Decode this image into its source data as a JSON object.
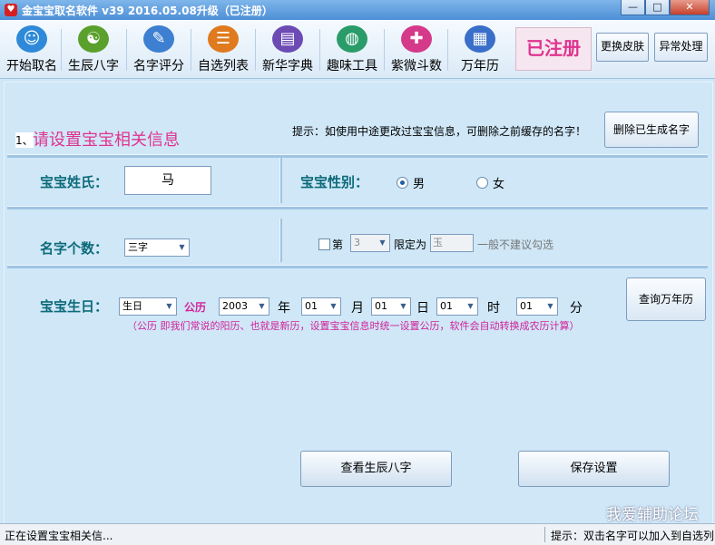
{
  "window": {
    "title": "金宝宝取名软件 v39   2016.05.08升级（已注册）",
    "minimize": "—",
    "maximize": "□",
    "close": "✕"
  },
  "toolbar": {
    "items": [
      {
        "label": "开始取名",
        "icon": "people-icon",
        "color": "#2e8ad8"
      },
      {
        "label": "生辰八字",
        "icon": "bagua-icon",
        "color": "#5aa02c"
      },
      {
        "label": "名字评分",
        "icon": "score-icon",
        "color": "#3d7fd0"
      },
      {
        "label": "自选列表",
        "icon": "list-icon",
        "color": "#e07a1f"
      },
      {
        "label": "新华字典",
        "icon": "dictionary-icon",
        "color": "#6c4bb5"
      },
      {
        "label": "趣味工具",
        "icon": "globe-icon",
        "color": "#2a9c6a"
      },
      {
        "label": "紫微斗数",
        "icon": "star-icon",
        "color": "#d5398a"
      },
      {
        "label": "万年历",
        "icon": "calendar-icon",
        "color": "#3a6fc9"
      }
    ],
    "registered_label": "已注册",
    "skin_button": "更换皮肤",
    "error_button": "异常处理"
  },
  "section": {
    "number": "1、",
    "title": "请设置宝宝相关信息",
    "hint": "提示：如使用中途更改过宝宝信息，可删除之前缓存的名字！",
    "delete_button": "删除已生成名字"
  },
  "surname": {
    "label": "宝宝姓氏：",
    "value": "马"
  },
  "gender": {
    "label": "宝宝性别：",
    "male": "男",
    "female": "女",
    "selected": "男"
  },
  "name_count": {
    "label": "名字个数：",
    "value": "三字"
  },
  "restrict": {
    "prefix": "第",
    "position": "3",
    "mid": "限定为",
    "char": "玉",
    "suffix": "一般不建议勾选"
  },
  "birth": {
    "label": "宝宝生日：",
    "type": "生日",
    "calendar": "公历",
    "year": "2003",
    "year_unit": "年",
    "month": "01",
    "month_unit": "月",
    "day": "01",
    "day_unit": "日",
    "hour": "01",
    "hour_unit": "时",
    "minute": "01",
    "minute_unit": "分",
    "calendar_button": "查询万年历",
    "note": "（公历   即我们常说的阳历、也就是新历，设置宝宝信息时统一设置公历，软件会自动转换成农历计算）"
  },
  "actions": {
    "view_bazi": "查看生辰八字",
    "save": "保存设置"
  },
  "watermark": "我爱辅助论坛",
  "status": {
    "left": "正在设置宝宝相关信...",
    "right": "提示：双击名字可以加入到自选列"
  }
}
